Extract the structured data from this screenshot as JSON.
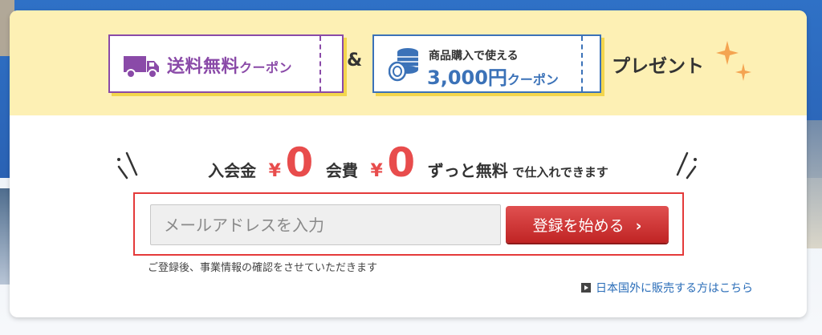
{
  "banner": {
    "coupon_shipping": {
      "title": "送料無料",
      "suffix": "クーポン"
    },
    "ampersand": "&",
    "coupon_yen": {
      "sub": "商品購入で使える",
      "amount": "3,000円",
      "suffix": "クーポン"
    },
    "present": "プレゼント"
  },
  "offer": {
    "entry_fee_label": "入会金",
    "entry_fee_currency": "¥",
    "entry_fee_value": "0",
    "membership_fee_label": "会費",
    "membership_fee_currency": "¥",
    "membership_fee_value": "0",
    "free_forever": "ずっと無料",
    "tail": "で仕入れできます"
  },
  "form": {
    "email_placeholder": "メールアドレスを入力",
    "email_value": "",
    "submit_label": "登録を始める",
    "submit_chevron": "›",
    "note": "ご登録後、事業情報の確認をさせていただきます"
  },
  "overseas_link": "日本国外に販売する方はこちら",
  "colors": {
    "accent_red": "#e84c4c",
    "purple": "#8a4aa8",
    "blue": "#3b72b8",
    "banner_bg": "#fdf0b4"
  }
}
